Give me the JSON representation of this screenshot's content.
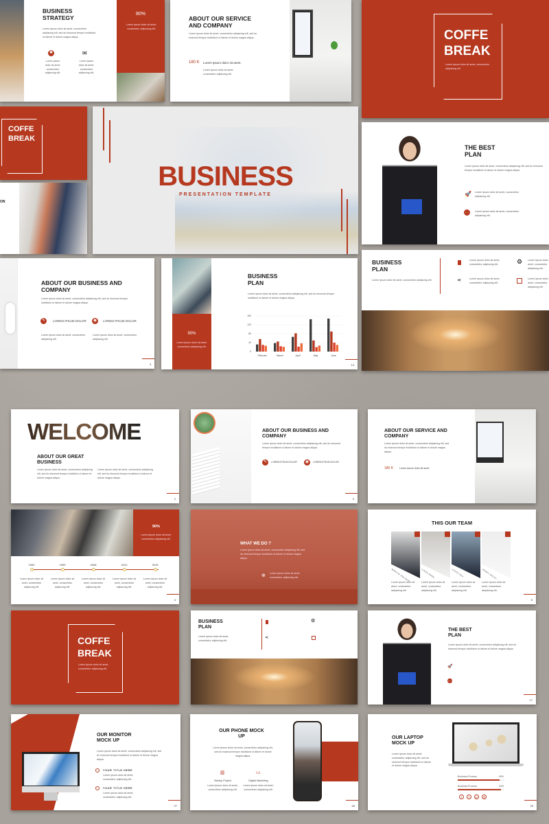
{
  "lorem": "Lorem ipsum dolor sit amet, consectetur adipiscing elit, sed do eiusmod tempor incididunt ut labore et dolore magna aliqua.",
  "lorem_short": "Lorem ipsum dolor sit amet, consectetur adipiscing elit.",
  "colors": {
    "accent": "#b5381f",
    "background": "#a8a29c"
  },
  "strategy": {
    "title": "BUSINESS STRATEGY",
    "percent": "80%",
    "icons": [
      "brain-icon",
      "mail-icon"
    ]
  },
  "service": {
    "title": "ABOUT OUR SERVICE AND COMPANY",
    "stat": "180 K",
    "stat_label": "Lorem ipsum dolor sit amet."
  },
  "coffee": {
    "title_1": "COFFE",
    "title_2": "BREAK"
  },
  "cover": {
    "title": "BUSINESS",
    "subtitle": "PRESENTATION TEMPLATE"
  },
  "partial": {
    "title_fragment": "ON"
  },
  "best_plan": {
    "title": "THE BEST PLAN",
    "page": "17"
  },
  "about_business": {
    "title": "ABOUT OUR BUSINESS AND COMPANY",
    "feature_1": "LOREM IPSUM DOLOR",
    "feature_2": "LOREM IPSUM DOLOR",
    "page": "3"
  },
  "business_plan_chart": {
    "title": "BUSINESS PLAN",
    "percent": "90%",
    "page": "14"
  },
  "chart_data": {
    "type": "bar",
    "categories": [
      "Februari",
      "March",
      "April",
      "May",
      "June"
    ],
    "ylim": [
      0,
      160
    ],
    "yticks": [
      0,
      40,
      80,
      120,
      160
    ],
    "series": [
      {
        "values": [
          32,
          38,
          66,
          145,
          148
        ],
        "color": "#3d3d3d"
      },
      {
        "values": [
          56,
          45,
          82,
          50,
          90
        ],
        "color": "#b5381f"
      },
      {
        "values": [
          30,
          24,
          22,
          20,
          40
        ],
        "color": "#e0402a"
      },
      {
        "values": [
          26,
          21,
          37,
          27,
          30
        ],
        "color": "#ec6a3a"
      }
    ]
  },
  "business_plan": {
    "title": "BUSINESS PLAN"
  },
  "welcome": {
    "title": "WELCOME",
    "subtitle": "ABOUT OUR GREAT BUSINESS",
    "page": "2"
  },
  "timeline": {
    "percent": "90%",
    "years": [
      "1992",
      "1999",
      "2008",
      "2012",
      "2019"
    ],
    "page": "4"
  },
  "what": {
    "title": "WHAT WE DO ?"
  },
  "team": {
    "title": "THIS OUR TEAM",
    "members": [
      "MARTIN HOLDEN",
      "LISSA ANNE",
      "LOUIS KEY",
      "JENNY RICHY"
    ],
    "page": "6"
  },
  "monitor": {
    "title": "OUR MONITOR MOCK UP",
    "item_1": "YOUR TITLE HERE",
    "item_2": "YOUR TITLE HERE",
    "page": "27"
  },
  "phone": {
    "title": "OUR PHONE MOCK UP",
    "item_1": "Startup Project",
    "item_2": "Digital Marketing",
    "page": "28"
  },
  "laptop": {
    "title": "OUR LAPTOP MOCK UP",
    "bar_1": "Business Process",
    "bar_1_value": "90%",
    "bar_2": "Business Process",
    "bar_2_value": "92%",
    "page": "29",
    "socials": [
      "twitter-icon",
      "facebook-icon",
      "pinterest-icon",
      "instagram-icon"
    ]
  }
}
